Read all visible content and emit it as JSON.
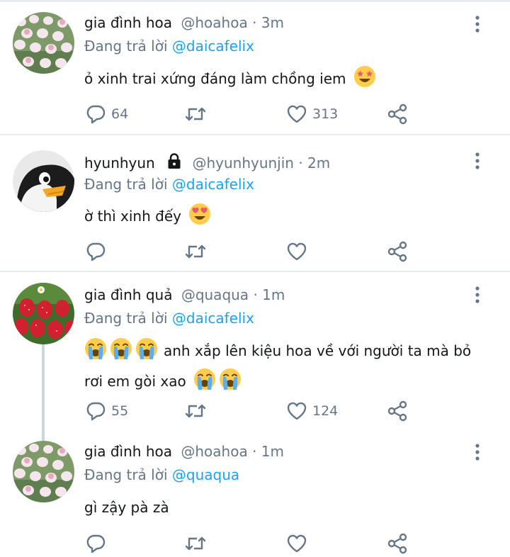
{
  "tweets": [
    {
      "name": "gia đình hoa",
      "handle": "@hoahoa",
      "time": "· 3m",
      "reply_prefix": "Đang trả lời ",
      "reply_to": "@daicafelix",
      "text": "ỏ xinh trai xứng đáng làm chồng iem",
      "emoji": [
        "star-struck-emoji"
      ],
      "replies": "64",
      "retweets": "",
      "likes": "313",
      "avatar": "tulip-field-photo"
    },
    {
      "name": "hyunhyun",
      "handle": "@hyunhyunjin",
      "time": "· 2m",
      "locked": true,
      "reply_prefix": "Đang trả lời ",
      "reply_to": "@daicafelix",
      "text": "ờ thì xinh đếy",
      "emoji": [
        "heart-eyes-emoji"
      ],
      "replies": "",
      "retweets": "",
      "likes": "",
      "avatar": "penguin-cartoon"
    },
    {
      "name": "gia đình quả",
      "handle": "@quaqua",
      "time": "· 1m",
      "reply_prefix": "Đang trả lời ",
      "reply_to": "@daicafelix",
      "text_line1": "anh xắp lên kiệu hoa về với người ta mà bỏ",
      "text_line2": "rơi em gòi xao",
      "emoji": [
        "loudly-crying-emoji"
      ],
      "replies": "55",
      "retweets": "",
      "likes": "124",
      "avatar": "strawberry-photo"
    },
    {
      "name": "gia đình hoa",
      "handle": "@hoahoa",
      "time": "· 1m",
      "reply_prefix": "Đang trả lời ",
      "reply_to": "@quaqua",
      "text": "gì zậy pà zà",
      "replies": "",
      "retweets": "",
      "likes": "",
      "avatar": "tulip-field-photo"
    }
  ],
  "colors": {
    "link": "#1da1f2",
    "secondary": "#657786",
    "separator": "#e6ecf0"
  }
}
